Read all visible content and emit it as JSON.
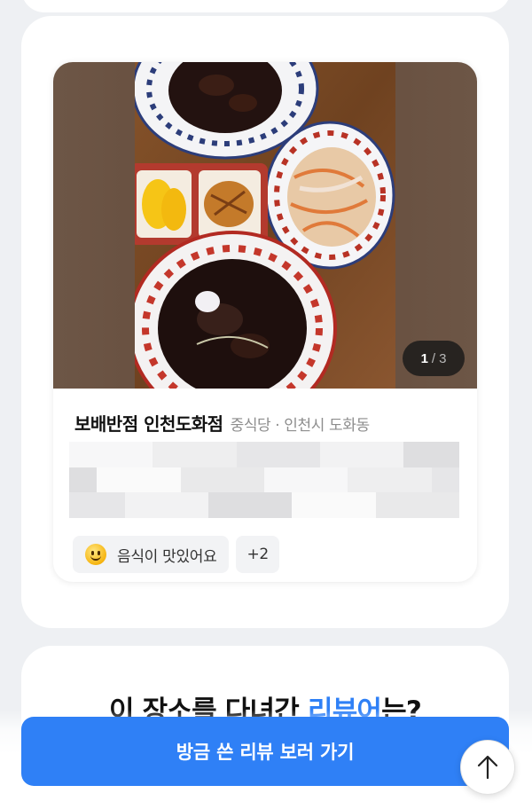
{
  "review_card": {
    "photo_counter": {
      "current": "1",
      "separator": "/",
      "total": "3"
    },
    "place_name": "보배반점 인천도화점",
    "place_meta": "중식당 · 인천시 도화동",
    "keyword_chips": [
      {
        "icon": "smiling-face-icon",
        "label": "음식이 맛있어요"
      },
      {
        "label": "+2"
      }
    ]
  },
  "reviewer_section": {
    "title_prefix": "이 장소를 다녀간 ",
    "title_accent": "리뷰어",
    "title_suffix": "는?"
  },
  "cta_button": {
    "label": "방금 쓴 리뷰 보러 가기"
  },
  "scroll_top": {
    "icon": "arrow-up-icon"
  },
  "colors": {
    "accent": "#2f80f6",
    "background": "#eef0f3"
  }
}
